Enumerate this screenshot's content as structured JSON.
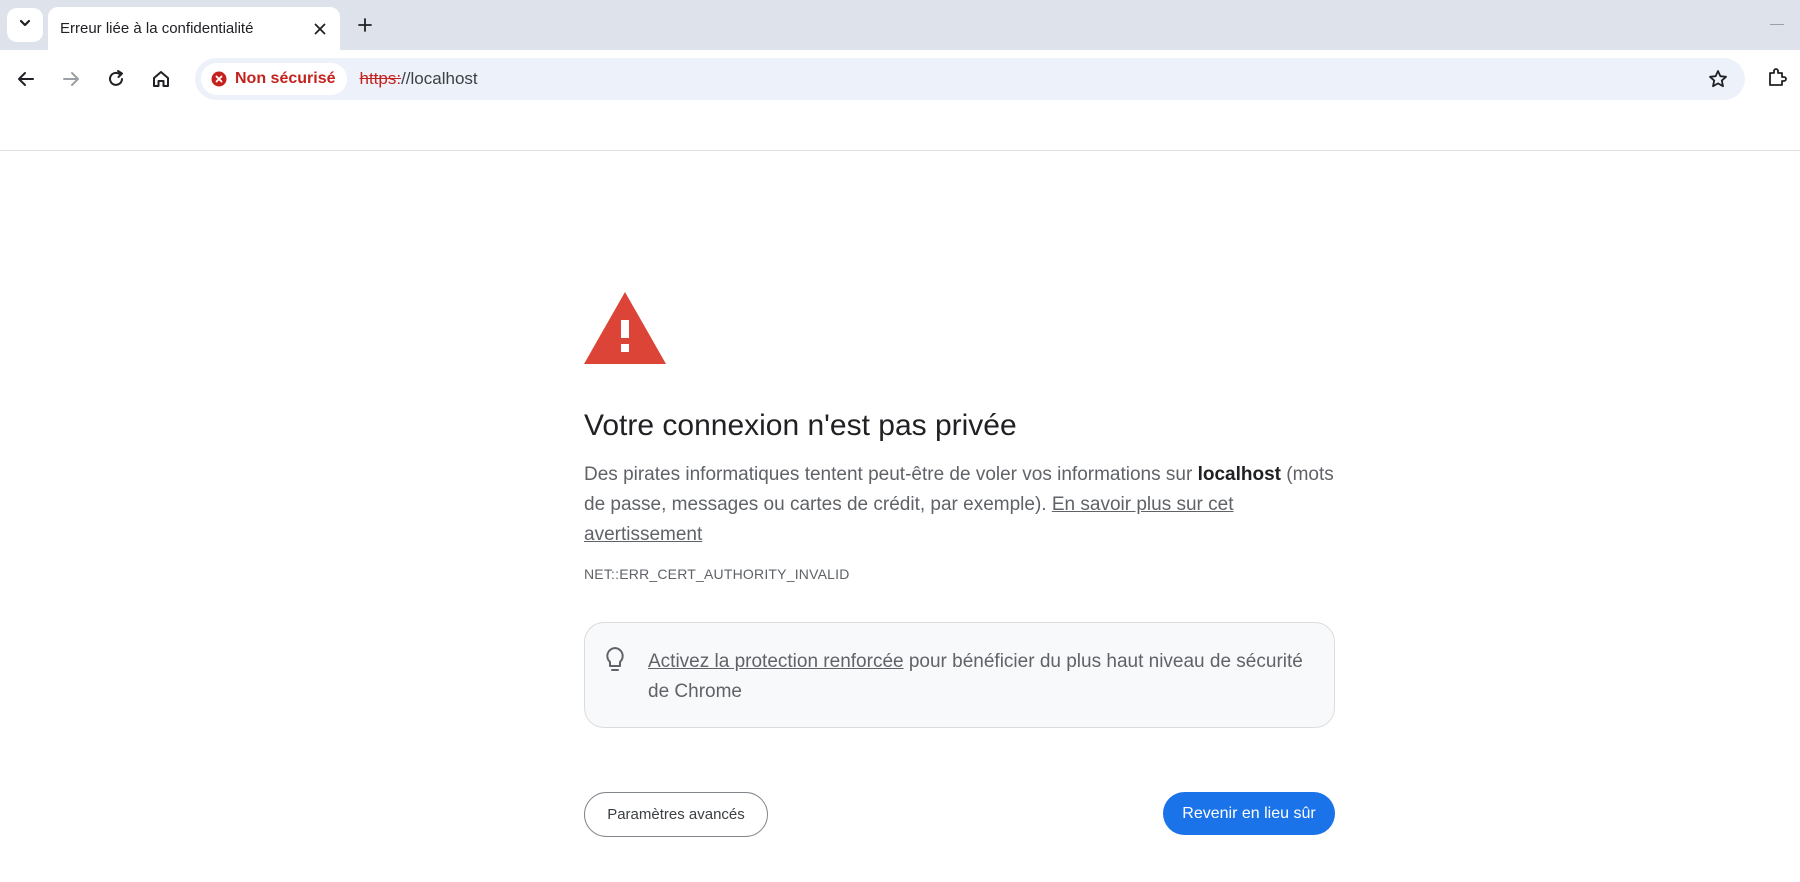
{
  "tab": {
    "title": "Erreur liée à la confidentialité"
  },
  "omnibox": {
    "security_chip": "Non sécurisé",
    "url_scheme": "https:",
    "url_rest": "//localhost"
  },
  "colors": {
    "tabstrip_bg": "#dee3eb",
    "omnibox_bg": "#edf2fa",
    "danger": "#c5221f",
    "warning_red": "#db4437",
    "primary_button": "#1a73e8"
  },
  "icons": {
    "tab_search": "chevron-down-icon",
    "tab_close": "close-icon",
    "new_tab": "plus-icon",
    "back": "arrow-left-icon",
    "forward": "arrow-right-icon",
    "reload": "reload-icon",
    "home": "home-icon",
    "security": "error-circle-icon",
    "bookmark": "star-icon",
    "extensions": "puzzle-icon",
    "warning": "warning-triangle-icon",
    "tip": "lightbulb-icon"
  },
  "page": {
    "heading": "Votre connexion n'est pas privée",
    "desc_before": "Des pirates informatiques tentent peut-être de voler vos informations sur ",
    "desc_host": "localhost",
    "desc_after": " (mots de passe, messages ou cartes de crédit, par exemple). ",
    "learn_more_link": "En savoir plus sur cet avertissement",
    "error_code": "NET::ERR_CERT_AUTHORITY_INVALID",
    "tip_link": "Activez la protection renforcée",
    "tip_text": " pour bénéficier du plus haut niveau de sécurité de Chrome",
    "advanced_button": "Paramètres avancés",
    "back_button": "Revenir en lieu sûr"
  }
}
